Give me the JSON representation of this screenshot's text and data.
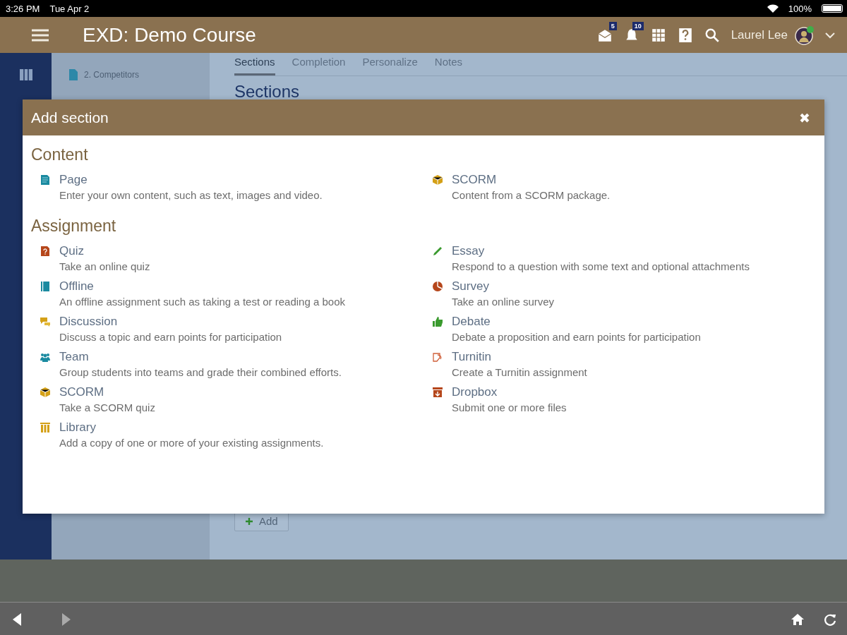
{
  "status_bar": {
    "time": "3:26 PM",
    "date": "Tue Apr 2",
    "battery": "100%"
  },
  "header": {
    "title": "EXD: Demo Course",
    "icons": [
      {
        "kind": "mail",
        "badge": "5"
      },
      {
        "kind": "bell",
        "badge": "10"
      },
      {
        "kind": "grid"
      },
      {
        "kind": "help"
      },
      {
        "kind": "search"
      }
    ],
    "user_name": "Laurel Lee"
  },
  "sidebar": {
    "items": [
      {
        "label": "2. Competitors"
      }
    ]
  },
  "tabs": [
    {
      "label": "Sections",
      "selected": true
    },
    {
      "label": "Completion",
      "selected": false
    },
    {
      "label": "Personalize",
      "selected": false
    },
    {
      "label": "Notes",
      "selected": false
    }
  ],
  "page_heading": "Sections",
  "add_button": "Add",
  "dialog": {
    "title": "Add section",
    "close": "✖",
    "groups": [
      {
        "heading": "Content",
        "columns": [
          [
            {
              "kind": "page",
              "name": "Page",
              "description": "Enter your own content, such as text, images and video."
            }
          ],
          [
            {
              "kind": "scorm",
              "name": "SCORM",
              "description": "Content from a SCORM package."
            }
          ]
        ]
      },
      {
        "heading": "Assignment",
        "columns": [
          [
            {
              "kind": "quiz",
              "name": "Quiz",
              "description": "Take an online quiz"
            },
            {
              "kind": "offline",
              "name": "Offline",
              "description": "An offline assignment such as taking a test or reading a book"
            },
            {
              "kind": "discussion",
              "name": "Discussion",
              "description": "Discuss a topic and earn points for participation"
            },
            {
              "kind": "team",
              "name": "Team",
              "description": "Group students into teams and grade their combined efforts."
            },
            {
              "kind": "scorm",
              "name": "SCORM",
              "description": "Take a SCORM quiz"
            },
            {
              "kind": "library",
              "name": "Library",
              "description": "Add a copy of one or more of your existing assignments."
            }
          ],
          [
            {
              "kind": "essay",
              "name": "Essay",
              "description": "Respond to a question with some text and optional attachments"
            },
            {
              "kind": "survey",
              "name": "Survey",
              "description": "Take an online survey"
            },
            {
              "kind": "debate",
              "name": "Debate",
              "description": "Debate a proposition and earn points for participation"
            },
            {
              "kind": "turnitin",
              "name": "Turnitin",
              "description": "Create a Turnitin assignment"
            },
            {
              "kind": "dropbox",
              "name": "Dropbox",
              "description": "Submit one or more files"
            }
          ]
        ]
      }
    ]
  }
}
